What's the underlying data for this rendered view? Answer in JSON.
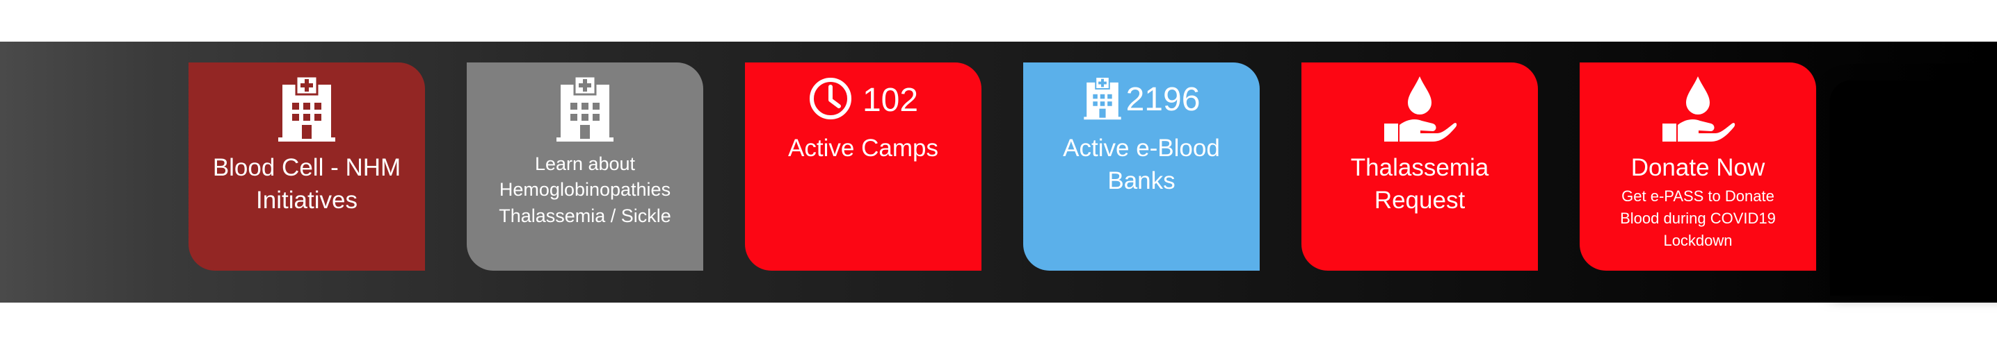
{
  "tiles": [
    {
      "id": "blood-cell",
      "label": "Blood Cell - NHM Initiatives",
      "icon": "hospital-icon",
      "color": "#932624"
    },
    {
      "id": "hemoglobinopathies",
      "label_lines": [
        "Learn about",
        "Hemoglobinopathies",
        "Thalassemia / Sickle"
      ],
      "icon": "hospital-icon",
      "color": "#7f7f7f"
    },
    {
      "id": "active-camps",
      "count": "102",
      "label": "Active Camps",
      "icon": "clock-icon",
      "color": "#fc0614"
    },
    {
      "id": "blood-banks",
      "count": "2196",
      "label": "Active e-Blood Banks",
      "icon": "hospital-icon",
      "color": "#5bb0ea"
    },
    {
      "id": "thalassemia-request",
      "label": "Thalassemia Request",
      "icon": "blood-donation-hand-icon",
      "color": "#fd0613"
    },
    {
      "id": "donate-now",
      "label": "Donate Now",
      "sublabel": "Get e-PASS to Donate Blood during COVID19 Lockdown",
      "icon": "blood-donation-hand-icon",
      "color": "#fd0613"
    }
  ]
}
